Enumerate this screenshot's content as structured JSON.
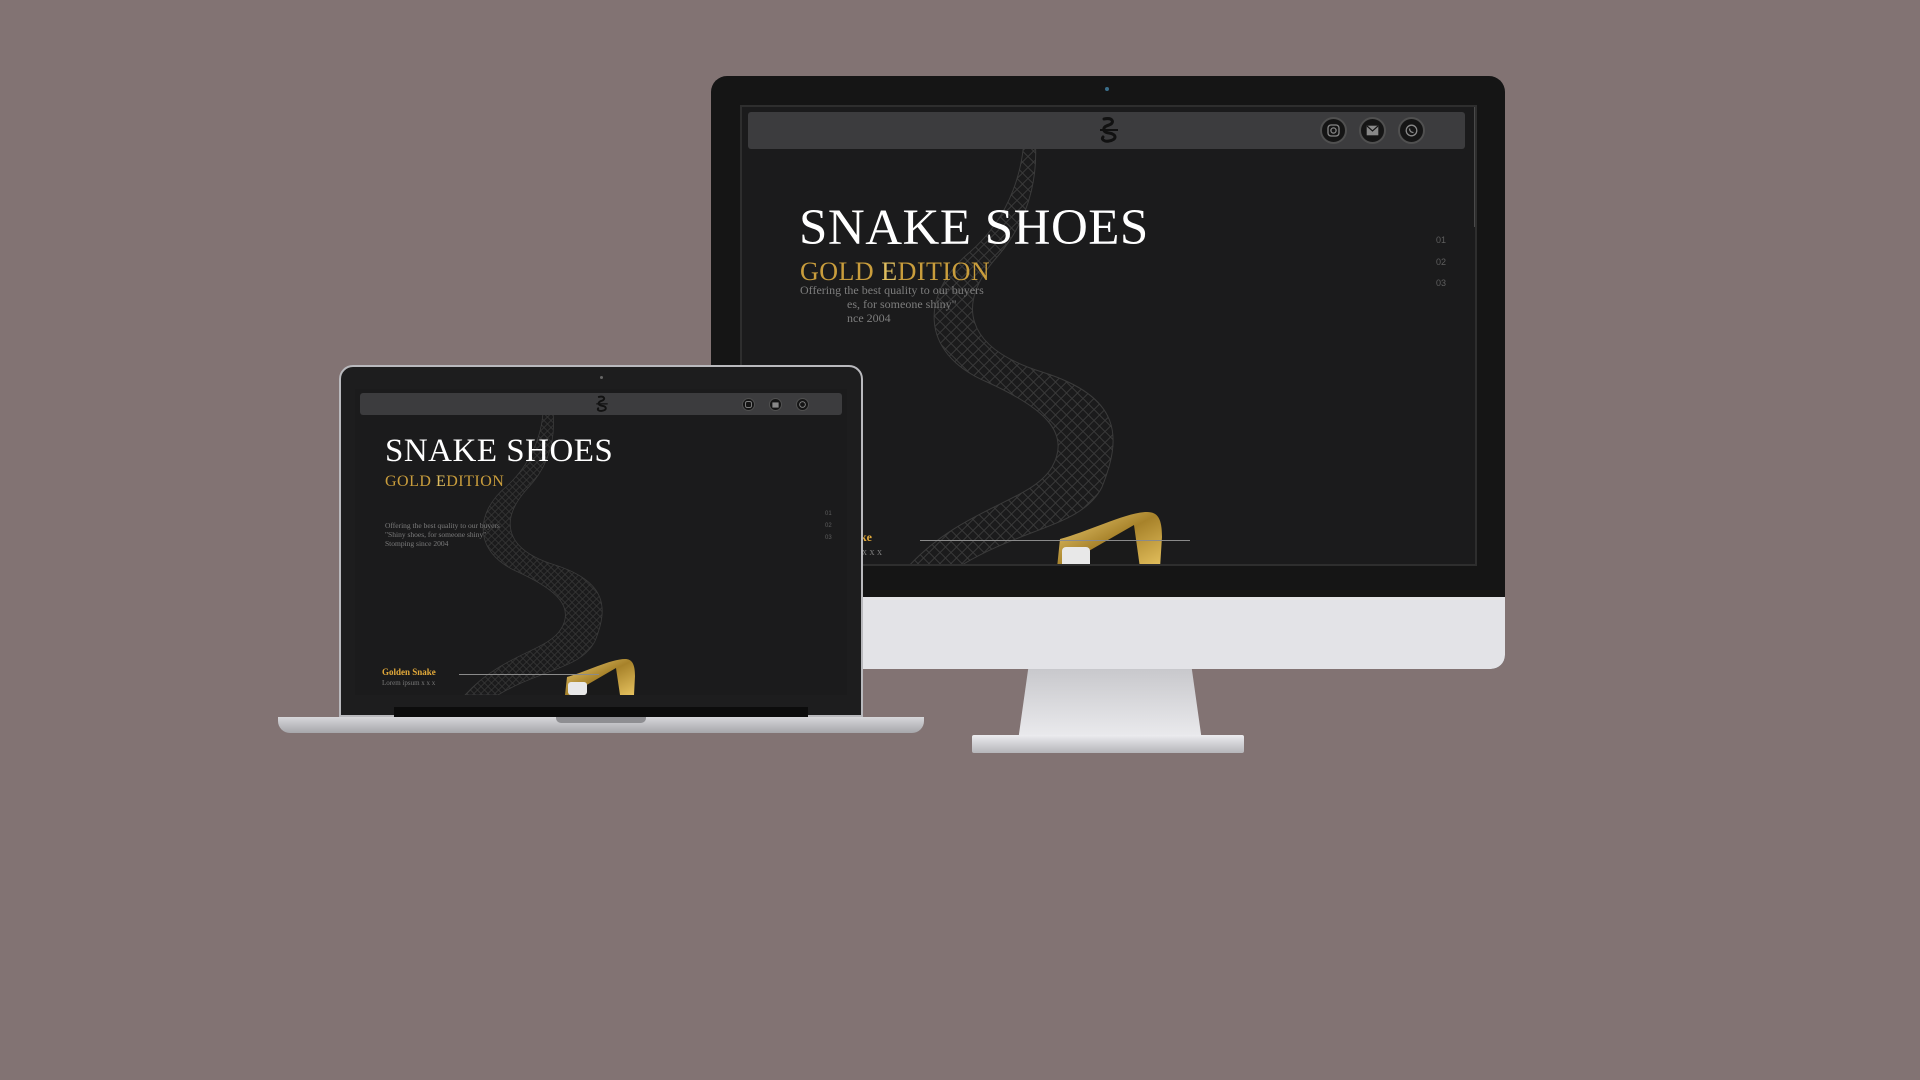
{
  "site": {
    "title": "SNAKE SHOES",
    "subtitle_prefix": "GOLD ",
    "subtitle_e": "E",
    "subtitle_suffix": "DITION",
    "tagline": [
      "Offering the best quality to our buyers",
      "\"Shiny shoes, for someone shiny\"",
      "Stomping since 2004"
    ],
    "slides": [
      "01",
      "02",
      "03"
    ],
    "product_name": "Golden Snake",
    "product_desc": "Lorem ipsum x x x",
    "social": [
      "instagram-icon",
      "mail-icon",
      "whatsapp-icon"
    ]
  },
  "desktop_visible": {
    "tagline": [
      "Offering the best quality to our buyers",
      "es, for someone shiny\"",
      "nce 2004"
    ],
    "product_name": "ke",
    "product_desc": "x x x"
  },
  "colors": {
    "background": "#827373",
    "screen": "#1b1b1c",
    "navbar": "#3c3c3e",
    "gold": "#c99d3c",
    "product_gold": "#e2a93a"
  }
}
